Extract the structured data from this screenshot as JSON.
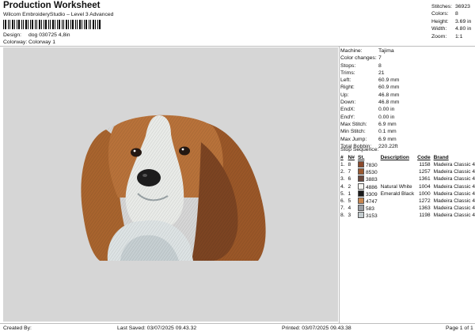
{
  "header": {
    "title": "Production Worksheet",
    "subtitle": "Wilcom EmbroideryStudio – Level 3 Advanced",
    "design_label": "Design:",
    "design_value": "dog 030725 4,8in",
    "colorway_label": "Colorway:",
    "colorway_value": "Colorway 1"
  },
  "stats": [
    {
      "label": "Stitches:",
      "value": "36923"
    },
    {
      "label": "Colors:",
      "value": "8"
    },
    {
      "label": "Height:",
      "value": "3.69 in"
    },
    {
      "label": "Width:",
      "value": "4.80 in"
    },
    {
      "label": "Zoom:",
      "value": "1:1"
    }
  ],
  "info": [
    {
      "label": "Machine:",
      "value": "Tajima"
    },
    {
      "label": "Color changes:",
      "value": "7"
    },
    {
      "label": "Stops:",
      "value": "8"
    },
    {
      "label": "Trims:",
      "value": "21"
    },
    {
      "label": "Left:",
      "value": "60.9 mm"
    },
    {
      "label": "Right:",
      "value": "60.9 mm"
    },
    {
      "label": "Up:",
      "value": "46.8 mm"
    },
    {
      "label": "Down:",
      "value": "46.8 mm"
    },
    {
      "label": "EndX:",
      "value": "0.00 in"
    },
    {
      "label": "EndY:",
      "value": "0.00 in"
    },
    {
      "label": "Max Stitch:",
      "value": "6.9 mm"
    },
    {
      "label": "Min Stitch:",
      "value": "0.1 mm"
    },
    {
      "label": "Max Jump:",
      "value": "6.9 mm"
    },
    {
      "label": "Total Bobbin:",
      "value": "220.22ft"
    }
  ],
  "stop_sequence": {
    "title": "Stop Sequence:",
    "headers": [
      "#",
      "N#",
      "St.",
      "Description",
      "Code",
      "Brand"
    ],
    "rows": [
      {
        "stop": "1.",
        "needle": "8",
        "color": "#8a4a2c",
        "code_num": "7830",
        "description": "",
        "stitches": "1158",
        "brand": "Madeira Classic 40"
      },
      {
        "stop": "2.",
        "needle": "7",
        "color": "#9c5a30",
        "code_num": "8530",
        "description": "",
        "stitches": "1257",
        "brand": "Madeira Classic 40"
      },
      {
        "stop": "3.",
        "needle": "6",
        "color": "#6b4a3e",
        "code_num": "3883",
        "description": "",
        "stitches": "1361",
        "brand": "Madeira Classic 40"
      },
      {
        "stop": "4.",
        "needle": "2",
        "color": "#f6f6f2",
        "code_num": "4886",
        "description": "Natural White",
        "stitches": "1004",
        "brand": "Madeira Classic 40"
      },
      {
        "stop": "5.",
        "needle": "1",
        "color": "#1a1a1a",
        "code_num": "3309",
        "description": "Emerald Black",
        "stitches": "1000",
        "brand": "Madeira Classic 40"
      },
      {
        "stop": "6.",
        "needle": "5",
        "color": "#c8864e",
        "code_num": "4747",
        "description": "",
        "stitches": "1272",
        "brand": "Madeira Classic 40"
      },
      {
        "stop": "7.",
        "needle": "4",
        "color": "#9a9ea4",
        "code_num": "583",
        "description": "",
        "stitches": "1363",
        "brand": "Madeira Classic 40"
      },
      {
        "stop": "8.",
        "needle": "3",
        "color": "#c4cccf",
        "code_num": "3153",
        "description": "",
        "stitches": "1198",
        "brand": "Madeira Classic 40"
      }
    ]
  },
  "footer": {
    "created_by": "Created By:",
    "last_saved": "Last Saved: 03/07/2025 09.43.32",
    "printed": "Printed: 03/07/2025 09.43.38",
    "page": "Page 1 of 1"
  }
}
